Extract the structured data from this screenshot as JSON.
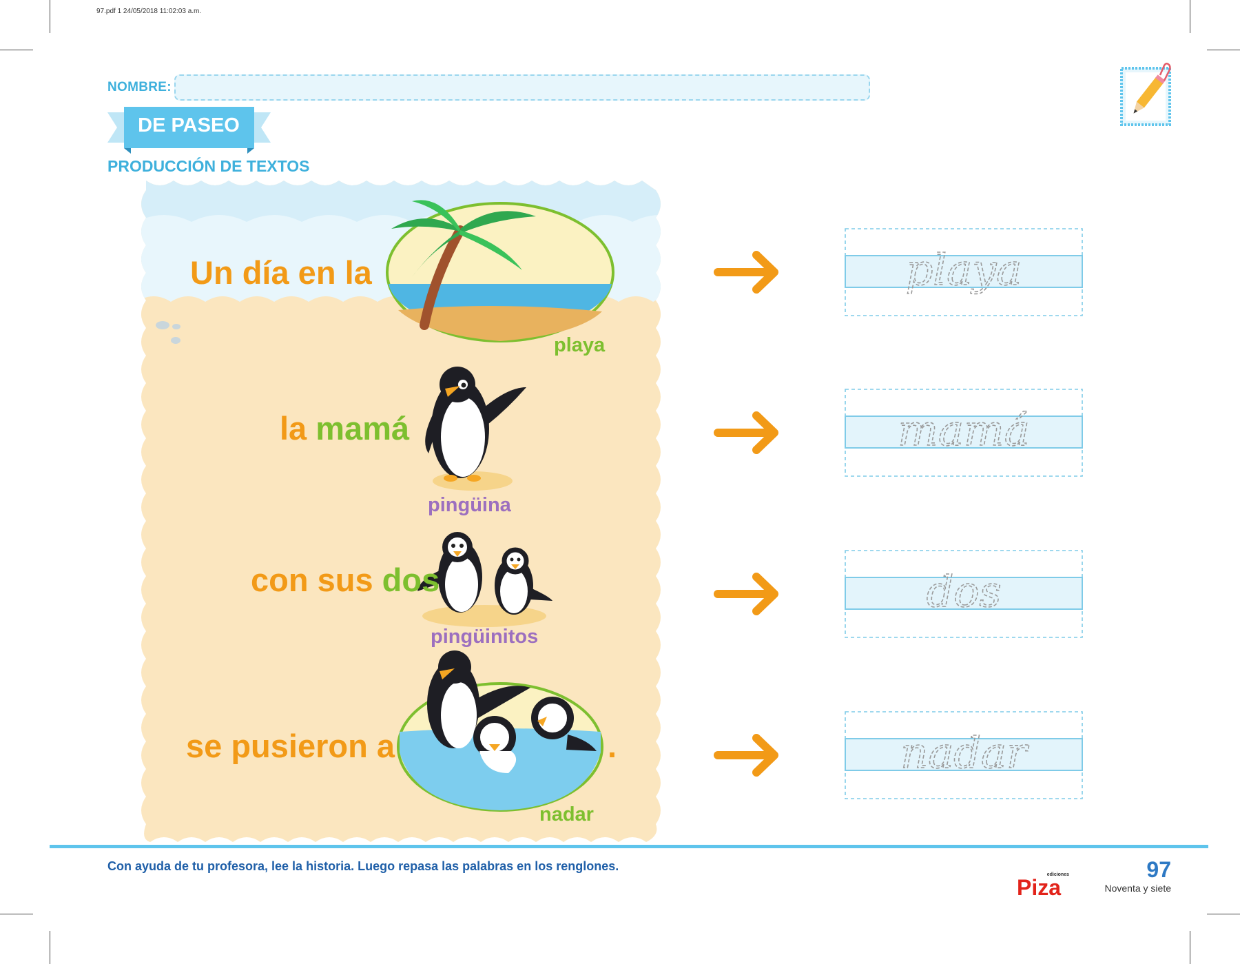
{
  "file_info": "97.pdf   1   24/05/2018   11:02:03 a.m.",
  "header": {
    "name_label": "NOMBRE:",
    "name_value": "",
    "ribbon_title": "DE PASEO",
    "subtitle": "PRODUCCIÓN DE TEXTOS"
  },
  "story": [
    {
      "parts": [
        {
          "text": "Un día en la",
          "color": "orange"
        }
      ],
      "caption": "playa",
      "caption_color": "green",
      "trace_word": "playa",
      "illustration": "palm-beach-illustration"
    },
    {
      "parts": [
        {
          "text": "la ",
          "color": "orange"
        },
        {
          "text": "mamá",
          "color": "green"
        }
      ],
      "caption": "pingüina",
      "caption_color": "purple",
      "trace_word": "mamá",
      "illustration": "mother-penguin-illustration"
    },
    {
      "parts": [
        {
          "text": "con sus ",
          "color": "orange"
        },
        {
          "text": "dos",
          "color": "green"
        }
      ],
      "caption": "pingüinitos",
      "caption_color": "purple",
      "trace_word": "dos",
      "illustration": "two-penguins-illustration"
    },
    {
      "parts": [
        {
          "text": "se pusieron a",
          "color": "orange"
        }
      ],
      "end_mark": ".",
      "caption": "nadar",
      "caption_color": "green",
      "trace_word": "nadar",
      "illustration": "penguins-swimming-illustration"
    }
  ],
  "colors": {
    "orange": "#f29a17",
    "green": "#7dbf2f",
    "purple": "#9c6fbf",
    "accent_blue": "#5ec4ec",
    "sand": "#fbe6bf",
    "trace_band": "#e3f4fb"
  },
  "footer": {
    "instructions": "Con ayuda de tu profesora, lee la historia. Luego repasa las palabras en los renglones.",
    "publisher_small": "ediciones",
    "publisher_name": "Piza",
    "page_number": "97",
    "page_number_words": "Noventa y siete"
  },
  "icons": [
    "pencil-icon",
    "paperclip-icon",
    "arrow-right-icon"
  ]
}
